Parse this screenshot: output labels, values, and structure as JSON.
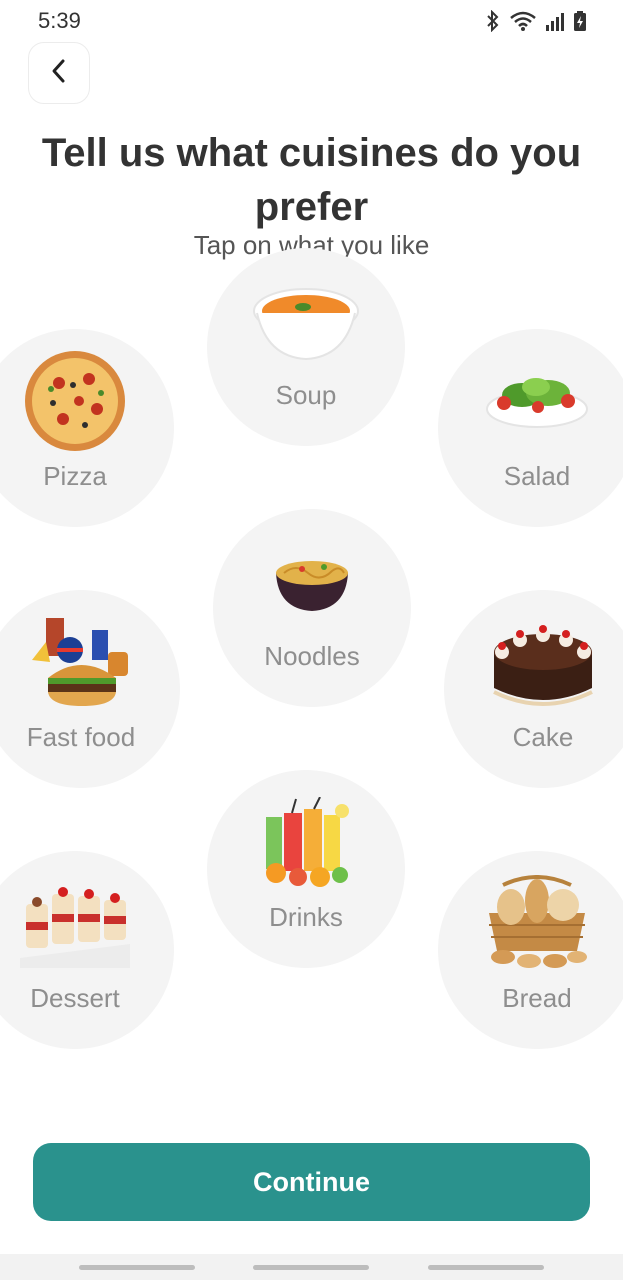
{
  "status": {
    "time": "5:39"
  },
  "header": {
    "title": "Tell us what cuisines do you prefer",
    "subtitle": "Tap on what you like"
  },
  "cuisines": [
    {
      "label": "Soup"
    },
    {
      "label": "Pizza"
    },
    {
      "label": "Salad"
    },
    {
      "label": "Noodles"
    },
    {
      "label": "Fast food"
    },
    {
      "label": "Cake"
    },
    {
      "label": "Drinks"
    },
    {
      "label": "Dessert"
    },
    {
      "label": "Bread"
    }
  ],
  "actions": {
    "continue_label": "Continue"
  },
  "colors": {
    "accent": "#2a928d",
    "bubble": "#f4f4f4",
    "label": "#8e8e8e"
  }
}
